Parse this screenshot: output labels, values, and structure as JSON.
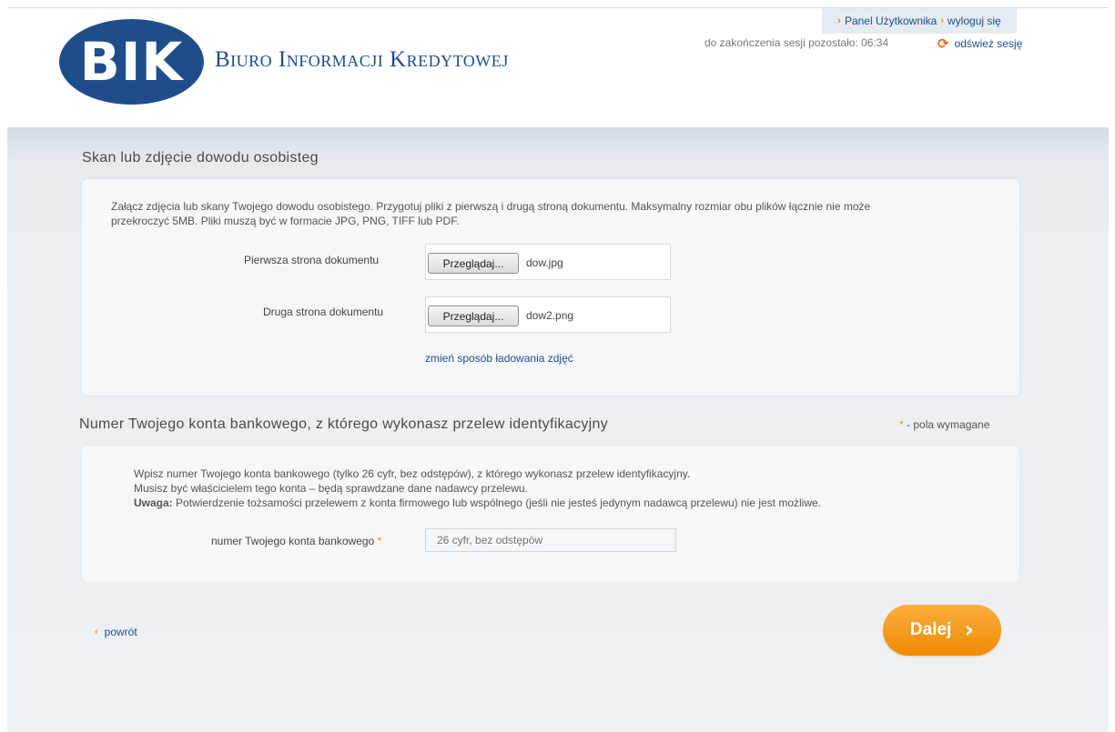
{
  "header": {
    "logo_mark": "BIK",
    "logo_text": "Biuro Informacji Kredytowej",
    "panel_link": "Panel Użytkownika",
    "logout_link": "wyloguj się",
    "session_text": "do zakończenia sesji pozostało: 06:34",
    "refresh_link": "odśwież sesję",
    "icons": {
      "link_arrow": "chevron-right-icon",
      "refresh": "refresh-icon"
    }
  },
  "scan_section": {
    "title": "Skan lub zdjęcie dowodu osobisteg",
    "description_line1": "Załącz zdjęcia lub skany Twojego dowodu osobistego. Przygotuj pliki z pierwszą i drugą stroną dokumentu. Maksymalny rozmiar obu plików łącznie nie może",
    "description_line2": "przekroczyć 5MB. Pliki muszą być w formacie JPG, PNG, TIFF lub PDF.",
    "first_page_label": "Pierwsza strona dokumentu",
    "second_page_label": "Druga strona dokumentu",
    "browse_label": "Przeglądaj...",
    "first_file": "dow.jpg",
    "second_file": "dow2.png",
    "change_link": "zmień sposób ładowania zdjęć"
  },
  "account_section": {
    "title": "Numer Twojego konta bankowego, z którego wykonasz przelew identyfikacyjny",
    "required_note": "- pola wymagane",
    "line1": "Wpisz numer Twojego konta bankowego (tylko 26 cyfr, bez odstępów), z którego wykonasz przelew identyfikacyjny.",
    "line2": "Musisz być właścicielem tego konta – będą sprawdzane dane nadawcy przelewu.",
    "warning_label": "Uwaga:",
    "warning_text": " Potwierdzenie tożsamości przelewem z konta firmowego lub wspólnego (jeśli nie jesteś jedynym nadawcą przelewu) nie jest możliwe.",
    "account_label": "numer Twojego konta bankowego",
    "account_placeholder": "26 cyfr, bez odstępów",
    "account_value": ""
  },
  "footer": {
    "back_label": "powrót",
    "next_label": "Dalej"
  },
  "colors": {
    "brand_blue": "#1f4d8c",
    "accent_orange": "#f29400",
    "background": "#eef1f3"
  }
}
